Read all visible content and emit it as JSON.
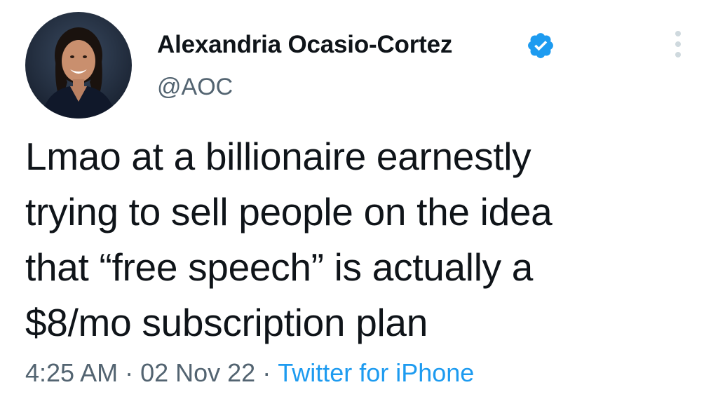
{
  "author": {
    "name": "Alexandria Ocasio-Cortez",
    "handle": "@AOC",
    "verified": true,
    "avatar_icon": "profile-photo"
  },
  "tweet": {
    "text_lines": [
      "Lmao at a billionaire earnestly",
      "trying to sell people on the idea",
      "that “free speech” is actually a",
      "$8/mo subscription plan"
    ]
  },
  "meta": {
    "time": "4:25 AM",
    "date": "02 Nov 22",
    "separator": "·",
    "source": "Twitter for iPhone"
  },
  "icons": {
    "verified": "verified-badge-icon",
    "more": "more-options-icon"
  },
  "colors": {
    "text": "#0f1419",
    "secondary": "#536471",
    "accent": "#1d9bf0",
    "more_icon": "#cfd9de"
  }
}
